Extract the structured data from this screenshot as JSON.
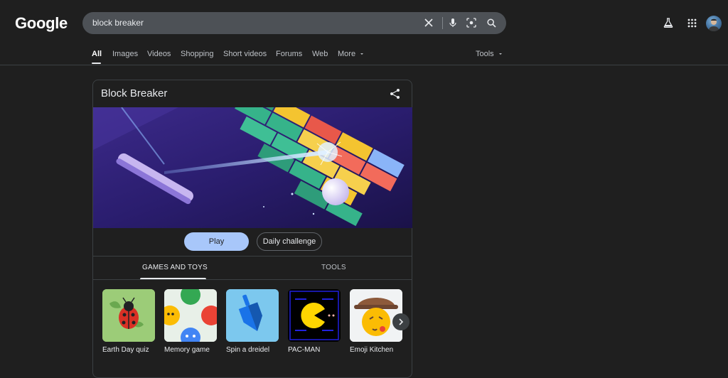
{
  "header": {
    "logo": "Google",
    "search": {
      "query": "block breaker"
    },
    "icons": [
      "clear-icon",
      "mic-icon",
      "lens-icon",
      "search-icon",
      "labs-icon",
      "apps-icon",
      "avatar"
    ]
  },
  "tabs": [
    {
      "label": "All",
      "active": true
    },
    {
      "label": "Images"
    },
    {
      "label": "Videos"
    },
    {
      "label": "Shopping"
    },
    {
      "label": "Short videos"
    },
    {
      "label": "Forums"
    },
    {
      "label": "Web"
    },
    {
      "label": "More"
    }
  ],
  "tools_label": "Tools",
  "card": {
    "title": "Block Breaker",
    "play_label": "Play",
    "daily_label": "Daily challenge",
    "tabs": [
      "GAMES AND TOYS",
      "TOOLS"
    ],
    "games": [
      {
        "label": "Earth Day quiz"
      },
      {
        "label": "Memory game"
      },
      {
        "label": "Spin a dreidel"
      },
      {
        "label": "PAC-MAN"
      },
      {
        "label": "Emoji Kitchen"
      }
    ]
  },
  "colors": {
    "background": "#1f1f1f",
    "search_bg": "#4d5156",
    "play_button": "#a8c7fa",
    "accent_text": "#e8eaed"
  }
}
